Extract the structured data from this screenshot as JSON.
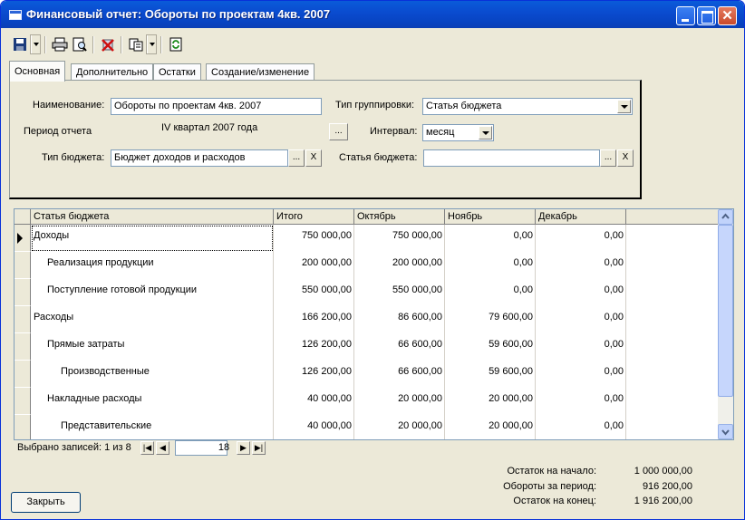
{
  "window": {
    "title": "Финансовый отчет: Обороты по проектам 4кв. 2007",
    "close_glyph": "✕"
  },
  "toolbar": {
    "icons": [
      "save-icon",
      "print-icon",
      "print-preview-icon",
      "delete-icon",
      "copy-icon",
      "refresh-icon"
    ]
  },
  "tabs": [
    {
      "label": "Основная",
      "active": true
    },
    {
      "label": "Дополнительно",
      "active": false
    },
    {
      "label": "Остатки",
      "active": false
    },
    {
      "label": "Создание/изменение",
      "active": false
    }
  ],
  "form": {
    "name_label": "Наименование:",
    "name_value": "Обороты по проектам 4кв. 2007",
    "period_label": "Период отчета",
    "period_value": "IV квартал 2007 года",
    "period_button": "...",
    "budget_type_label": "Тип бюджета:",
    "budget_type_value": "Бюджет доходов и расходов",
    "budget_type_btn": "...",
    "budget_type_clear": "X",
    "grouping_label": "Тип группировки:",
    "grouping_value": "Статья бюджета",
    "interval_label": "Интервал:",
    "interval_value": "месяц",
    "budget_item_label": "Статья бюджета:",
    "budget_item_value": "",
    "budget_item_btn": "...",
    "budget_item_clear": "X"
  },
  "grid": {
    "columns": [
      "Статья бюджета",
      "Итого",
      "Октябрь",
      "Ноябрь",
      "Декабрь"
    ],
    "rows": [
      {
        "name": "Доходы",
        "indent": 0,
        "total": "750 000,00",
        "oct": "750 000,00",
        "nov": "0,00",
        "dec": "0,00",
        "current": true
      },
      {
        "name": "Реализация продукции",
        "indent": 1,
        "total": "200 000,00",
        "oct": "200 000,00",
        "nov": "0,00",
        "dec": "0,00"
      },
      {
        "name": "Поступление готовой продукции",
        "indent": 1,
        "total": "550 000,00",
        "oct": "550 000,00",
        "nov": "0,00",
        "dec": "0,00"
      },
      {
        "name": "Расходы",
        "indent": 0,
        "total": "166 200,00",
        "oct": "86 600,00",
        "nov": "79 600,00",
        "dec": "0,00"
      },
      {
        "name": "Прямые затраты",
        "indent": 1,
        "total": "126 200,00",
        "oct": "66 600,00",
        "nov": "59 600,00",
        "dec": "0,00"
      },
      {
        "name": "Производственные",
        "indent": 2,
        "total": "126 200,00",
        "oct": "66 600,00",
        "nov": "59 600,00",
        "dec": "0,00"
      },
      {
        "name": "Накладные расходы",
        "indent": 1,
        "total": "40 000,00",
        "oct": "20 000,00",
        "nov": "20 000,00",
        "dec": "0,00"
      },
      {
        "name": "Представительские",
        "indent": 2,
        "total": "40 000,00",
        "oct": "20 000,00",
        "nov": "20 000,00",
        "dec": "0,00"
      }
    ]
  },
  "navigator": {
    "selected_text": "Выбрано записей: 1 из 8",
    "current": "1",
    "total": "8",
    "first": "|◀",
    "prev": "◀",
    "next": "▶",
    "last": "▶|"
  },
  "summary": {
    "start_label": "Остаток на начало:",
    "start_value": "1 000 000,00",
    "period_label": "Обороты за период:",
    "period_value": "916 200,00",
    "end_label": "Остаток на конец:",
    "end_value": "1 916 200,00"
  },
  "buttons": {
    "close_label": "Закрыть"
  }
}
